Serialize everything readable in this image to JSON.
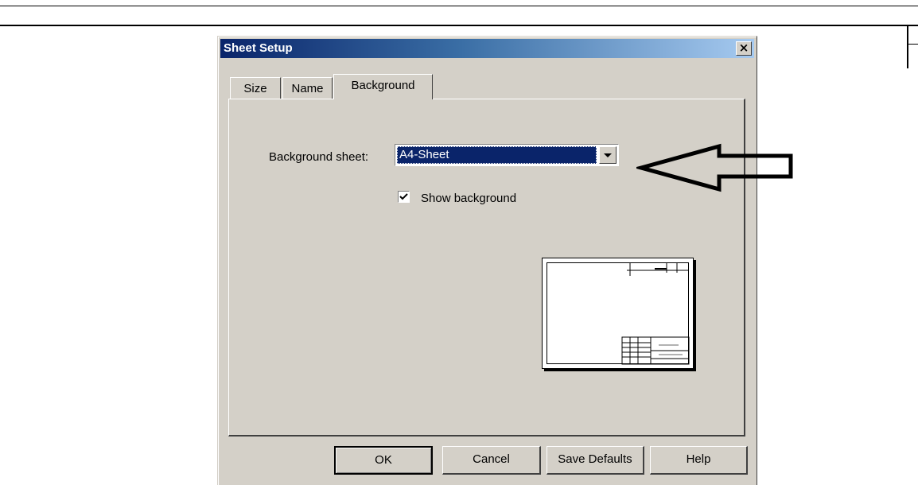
{
  "dialog": {
    "title": "Sheet Setup",
    "close_glyph": "×",
    "tabs": [
      {
        "label": "Size",
        "active": false
      },
      {
        "label": "Name",
        "active": false
      },
      {
        "label": "Background",
        "active": true
      }
    ],
    "background_tab": {
      "sheet_label": "Background sheet:",
      "sheet_value": "A4-Sheet",
      "show_background_label": "Show background",
      "show_background_checked": true
    },
    "buttons": {
      "ok": "OK",
      "cancel": "Cancel",
      "save_defaults": "Save Defaults",
      "help": "Help"
    }
  },
  "colors": {
    "titlebar_start": "#0a246a",
    "titlebar_end": "#a6caf0",
    "face": "#d4d0c8",
    "selection": "#0a246a"
  },
  "annotation": {
    "icon": "left-arrow-icon"
  }
}
